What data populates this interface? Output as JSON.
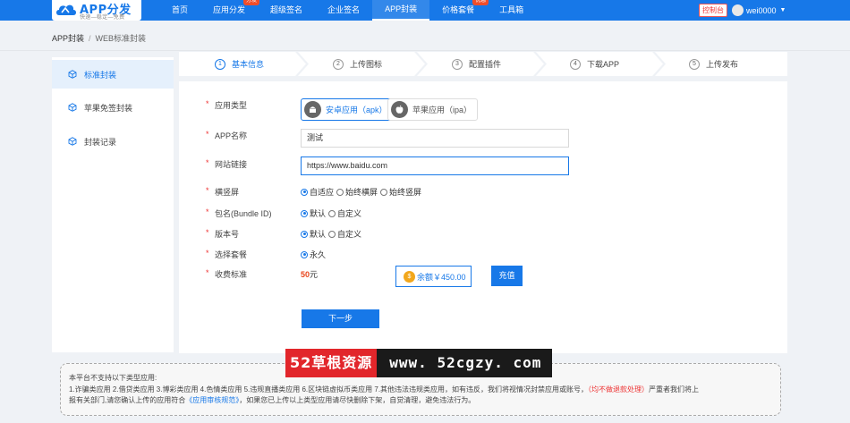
{
  "colors": {
    "primary": "#1778e8",
    "danger": "#e33333",
    "price": "#e8471e",
    "background": "#eff2f6"
  },
  "logo": {
    "title": "APP分发",
    "subtitle": "快速—稳定—免费"
  },
  "nav": {
    "items": [
      {
        "label": "首页",
        "badge": ""
      },
      {
        "label": "应用分发",
        "badge": "分发"
      },
      {
        "label": "超级签名",
        "badge": ""
      },
      {
        "label": "企业签名",
        "badge": ""
      },
      {
        "label": "APP封装",
        "badge": ""
      },
      {
        "label": "价格套餐",
        "badge": "优惠"
      },
      {
        "label": "工具箱",
        "badge": ""
      }
    ],
    "active": "APP封装",
    "control_label": "控制台",
    "username": "wei0000"
  },
  "breadcrumb": {
    "root": "APP封装",
    "current": "WEB标准封装"
  },
  "sidebar": {
    "items": [
      {
        "label": "标准封装",
        "icon": "cube-icon"
      },
      {
        "label": "苹果免签封装",
        "icon": "cube-icon"
      },
      {
        "label": "封装记录",
        "icon": "cube-icon"
      }
    ]
  },
  "steps": [
    {
      "num": "1",
      "label": "基本信息"
    },
    {
      "num": "2",
      "label": "上传图标"
    },
    {
      "num": "3",
      "label": "配置插件"
    },
    {
      "num": "4",
      "label": "下载APP"
    },
    {
      "num": "5",
      "label": "上传发布"
    }
  ],
  "form": {
    "app_type": {
      "label": "应用类型",
      "android": "安卓应用（apk）",
      "ios": "苹果应用（ipa）"
    },
    "app_name": {
      "label": "APP名称",
      "value": "测试"
    },
    "website": {
      "label": "网站链接",
      "value": "https://www.baidu.com"
    },
    "orientation": {
      "label": "横竖屏",
      "options": [
        "自适应",
        "始终横屏",
        "始终竖屏"
      ],
      "selected": "自适应"
    },
    "bundle": {
      "label": "包名(Bundle ID)",
      "options": [
        "默认",
        "自定义"
      ],
      "selected": "默认"
    },
    "version": {
      "label": "版本号",
      "options": [
        "默认",
        "自定义"
      ],
      "selected": "默认"
    },
    "plan": {
      "label": "选择套餐",
      "options": [
        "永久"
      ],
      "selected": "永久"
    },
    "fee": {
      "label": "收费标准",
      "amount": "50",
      "unit": "元"
    },
    "balance": "余额￥450.00",
    "recharge": "充值",
    "next": "下一步"
  },
  "notice": {
    "line1": "本平台不支持以下类型应用:",
    "line2a": "1.诈骗类应用 2.借贷类应用 3.博彩类应用 4.色情类应用 5.违规直播类应用 6.区块链虚拟币类应用 7.其他违法违规类应用，如有违反，我们将视情况封禁应用或账号，",
    "line2b": "（均不做退款处理）",
    "line2c": "严重者我们将上",
    "line3a": "报有关部门,请您确认上传的应用符合",
    "line3b": "《应用审核规范》",
    "line3c": "，如果您已上传以上类型应用请尽快删除下架，自觉清理，避免违法行为。"
  },
  "watermark": {
    "left": "52草根资源",
    "right": "www. 52cgzy. com"
  }
}
